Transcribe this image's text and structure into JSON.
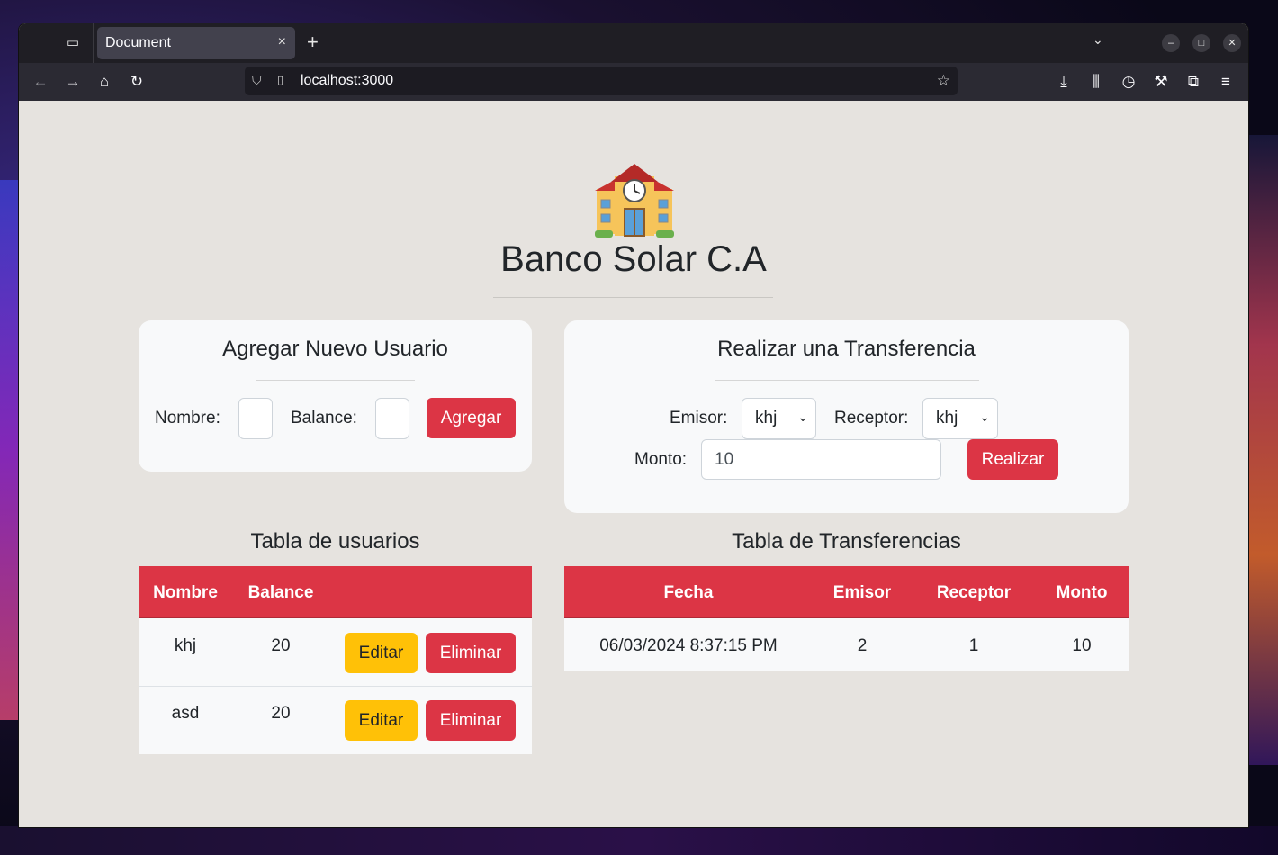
{
  "browser": {
    "tab_title": "Document",
    "tab_close": "×",
    "new_tab": "+",
    "url": "localhost:3000"
  },
  "page": {
    "title": "Banco Solar C.A",
    "logo_icon": "school-building-emoji"
  },
  "add_user": {
    "title": "Agregar Nuevo Usuario",
    "nombre_label": "Nombre:",
    "nombre_value": "",
    "balance_label": "Balance:",
    "balance_value": "",
    "submit_label": "Agregar"
  },
  "transfer": {
    "title": "Realizar una Transferencia",
    "emisor_label": "Emisor:",
    "emisor_value": "khj",
    "receptor_label": "Receptor:",
    "receptor_value": "khj",
    "monto_label": "Monto:",
    "monto_value": "10",
    "submit_label": "Realizar"
  },
  "users_table": {
    "title": "Tabla de usuarios",
    "headers": [
      "Nombre",
      "Balance"
    ],
    "rows": [
      {
        "nombre": "khj",
        "balance": "20"
      },
      {
        "nombre": "asd",
        "balance": "20"
      }
    ],
    "edit_label": "Editar",
    "delete_label": "Eliminar"
  },
  "transfers_table": {
    "title": "Tabla de Transferencias",
    "headers": [
      "Fecha",
      "Emisor",
      "Receptor",
      "Monto"
    ],
    "rows": [
      {
        "fecha": "06/03/2024 8:37:15 PM",
        "emisor": "2",
        "receptor": "1",
        "monto": "10"
      }
    ]
  },
  "colors": {
    "danger": "#dc3545",
    "warning": "#ffc107",
    "page_bg": "#e6e3df",
    "card_bg": "#f8f9fa"
  }
}
